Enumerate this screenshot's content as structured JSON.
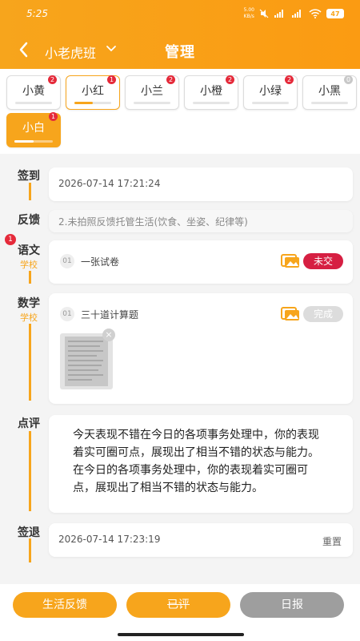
{
  "status_bar": {
    "time": "5:25",
    "net_speed": "5.00",
    "net_unit": "KB/s",
    "battery": "47"
  },
  "header": {
    "class_name": "小老虎班",
    "title": "管理",
    "bg_color": "#f7a51c"
  },
  "students": [
    {
      "name": "小黄",
      "badge": "2",
      "progress": 0.0,
      "state": "normal"
    },
    {
      "name": "小红",
      "badge": "1",
      "progress": 0.5,
      "state": "selected"
    },
    {
      "name": "小兰",
      "badge": "2",
      "progress": 0.0,
      "state": "normal"
    },
    {
      "name": "小橙",
      "badge": "2",
      "progress": 0.0,
      "state": "normal"
    },
    {
      "name": "小绿",
      "badge": "2",
      "progress": 0.0,
      "state": "normal"
    },
    {
      "name": "小黑",
      "badge": "0",
      "progress": 0.0,
      "state": "normal"
    },
    {
      "name": "小白",
      "badge": "1",
      "progress": 0.5,
      "state": "active"
    }
  ],
  "sign_in": {
    "label": "签到",
    "time": "2026-07-14 17:21:24"
  },
  "feedback": {
    "label": "反馈",
    "text": "2.未拍照反馈托管生活(饮食、坐姿、纪律等)"
  },
  "chinese": {
    "label": "语文",
    "sub": "学校",
    "badge": "1",
    "task_no": "01",
    "task": "一张试卷",
    "status": "未交"
  },
  "math": {
    "label": "数学",
    "sub": "学校",
    "task_no": "01",
    "task": "三十道计算题",
    "status": "完成",
    "close_icon": "×"
  },
  "review": {
    "label": "点评",
    "text": "今天表现不错在今日的各项事务处理中，你的表现着实可圈可点，展现出了相当不错的状态与能力。在今日的各项事务处理中，你的表现着实可圈可点，展现出了相当不错的状态与能力。"
  },
  "sign_out": {
    "label": "签退",
    "time": "2026-07-14 17:23:19",
    "reset": "重置"
  },
  "bottom": {
    "life_feedback": "生活反馈",
    "reviewed": "已评",
    "daily_report": "日报"
  },
  "colors": {
    "accent": "#f7a51c",
    "danger": "#d61f42",
    "badge": "#e52a3a"
  }
}
